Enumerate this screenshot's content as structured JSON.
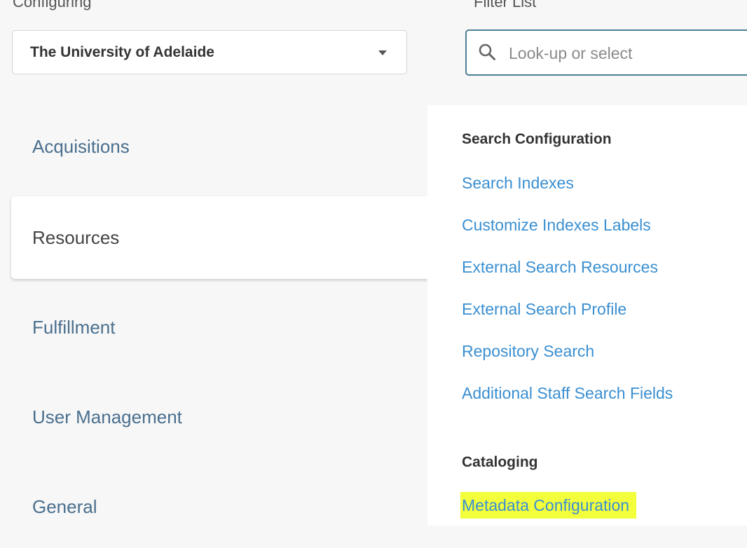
{
  "configuring": {
    "label": "Configuring",
    "selected": "The University of Adelaide"
  },
  "filter": {
    "label": "Filter List",
    "placeholder": "Look-up or select"
  },
  "nav": {
    "items": [
      {
        "label": "Acquisitions"
      },
      {
        "label": "Resources"
      },
      {
        "label": "Fulfillment"
      },
      {
        "label": "User Management"
      },
      {
        "label": "General"
      }
    ],
    "active": "Resources"
  },
  "panel": {
    "sections": [
      {
        "title": "Search Configuration",
        "links": [
          "Search Indexes",
          "Customize Indexes Labels",
          "External Search Resources",
          "External Search Profile",
          "Repository Search",
          "Additional Staff Search Fields"
        ]
      },
      {
        "title": "Cataloging",
        "links": [
          "Metadata Configuration"
        ]
      }
    ]
  },
  "colors": {
    "link": "#3a8fd1",
    "nav_text": "#4a6f8e",
    "highlight": "#f3ff3b",
    "focus_border": "#4e8093"
  },
  "icons": {
    "filter_search": "search-icon",
    "dropdown": "chevron-down-icon"
  }
}
